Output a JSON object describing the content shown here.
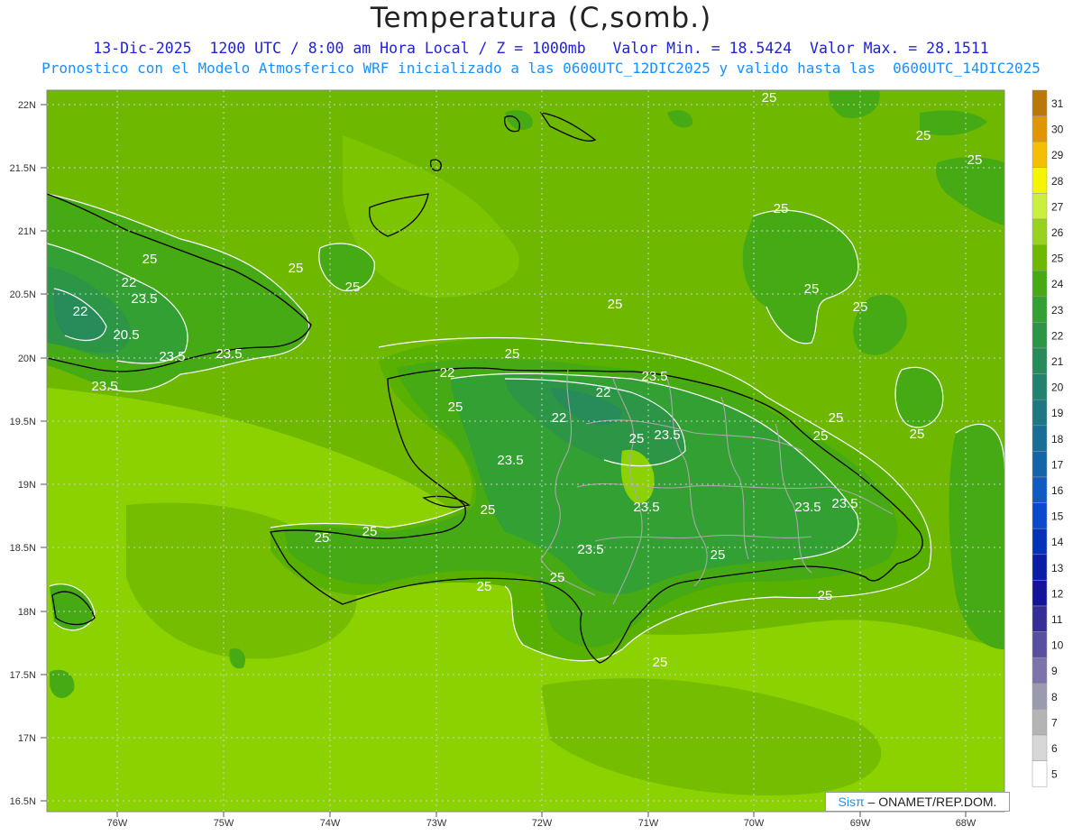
{
  "header": {
    "title": "Temperatura (C,somb.)",
    "line1": "13-Dic-2025  1200 UTC / 8:00 am Hora Local / Z = 1000mb   Valor Min. = 18.5424  Valor Max. = 28.1511",
    "line2": "Pronostico con el Modelo Atmosferico WRF inicializado a las 0600UTC_12DIC2025 y valido hasta las  0600UTC_14DIC2025"
  },
  "axes": {
    "lat_labels": [
      "22N",
      "21.5N",
      "21N",
      "20.5N",
      "20N",
      "19.5N",
      "19N",
      "18.5N",
      "18N",
      "17.5N",
      "17N",
      "16.5N"
    ],
    "lon_labels": [
      "76W",
      "75W",
      "74W",
      "73W",
      "72W",
      "71W",
      "70W",
      "69W",
      "68W"
    ]
  },
  "contour_labels": [
    "25",
    "25",
    "25",
    "25",
    "25",
    "25",
    "25",
    "25",
    "25",
    "25",
    "22",
    "22",
    "23.5",
    "20.5",
    "23.5",
    "25",
    "23.5",
    "23.5",
    "22",
    "22",
    "23.5",
    "22",
    "23.5",
    "25",
    "25",
    "23.5",
    "25",
    "23.5",
    "23.5",
    "23.5",
    "25",
    "23.5",
    "25",
    "25",
    "25",
    "25",
    "25",
    "25",
    "25",
    "25",
    "25"
  ],
  "colorbar": {
    "labels": [
      "31",
      "30",
      "29",
      "28",
      "27",
      "26",
      "25",
      "24",
      "23",
      "22",
      "21",
      "20",
      "19",
      "18",
      "17",
      "16",
      "15",
      "14",
      "13",
      "12",
      "11",
      "10",
      "9",
      "8",
      "7",
      "6",
      "5"
    ],
    "colors": [
      "#b8780a",
      "#e09600",
      "#f5be00",
      "#f5f500",
      "#c8f03c",
      "#96d21e",
      "#6eb900",
      "#46aa14",
      "#32a032",
      "#2d9646",
      "#278c5a",
      "#23826e",
      "#1e7882",
      "#196e96",
      "#1464aa",
      "#0f5ac3",
      "#0a4bcd",
      "#0532b9",
      "#0a1ea5",
      "#14149b",
      "#372d96",
      "#5a50a0",
      "#7d73aa",
      "#9b9baf",
      "#b4b4b4",
      "#d7d7d7",
      "#ffffff"
    ]
  },
  "credit": {
    "sis": "Sisπ",
    "rest": " – ONAMET/REP.DOM."
  }
}
